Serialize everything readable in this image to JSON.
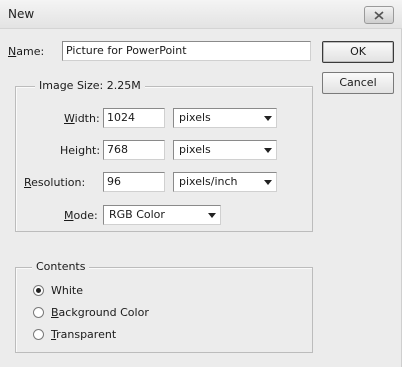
{
  "window": {
    "title": "New"
  },
  "name": {
    "label_u": "N",
    "label_rest": "ame:",
    "value": "Picture for PowerPoint"
  },
  "buttons": {
    "ok": "OK",
    "cancel": "Cancel"
  },
  "image_size": {
    "legend": "Image Size:  2.25M",
    "width": {
      "label_u": "W",
      "label_rest": "idth:",
      "value": "1024",
      "unit": "pixels"
    },
    "height": {
      "label": "Height:",
      "value": "768",
      "unit": "pixels"
    },
    "resolution": {
      "label_u": "R",
      "label_rest": "esolution:",
      "value": "96",
      "unit": "pixels/inch"
    },
    "mode": {
      "label_u": "M",
      "label_rest": "ode:",
      "value": "RGB Color"
    }
  },
  "contents": {
    "legend": "Contents",
    "options": [
      {
        "label": "White",
        "checked": true
      },
      {
        "label_u": "B",
        "label_rest": "ackground Color",
        "checked": false
      },
      {
        "label_u": "T",
        "label_rest": "ransparent",
        "checked": false
      }
    ]
  },
  "icons": {
    "close": "close-icon",
    "dropdown": "chevron-down-icon"
  }
}
